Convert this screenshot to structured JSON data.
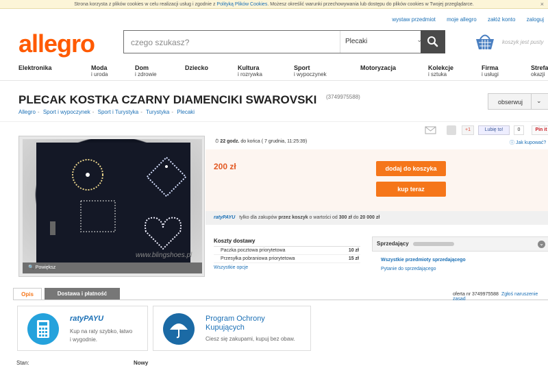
{
  "cookie": {
    "text_a": "Strona korzysta z plików cookies w celu realizacji usług i zgodnie z ",
    "link": "Polityką Plików Cookies",
    "text_b": ". Możesz określić warunki przechowywania lub dostępu do plików cookies w Twojej przeglądarce.",
    "close": "×"
  },
  "toplinks": [
    "wystaw przedmiot",
    "moje allegro",
    "załóż konto",
    "zaloguj"
  ],
  "logo": "allegro",
  "search": {
    "placeholder": "czego szukasz?",
    "category": "Plecaki"
  },
  "cart_empty": "koszyk jest pusty",
  "nav": [
    {
      "label": "Elektronika",
      "sub": ""
    },
    {
      "label": "Moda",
      "sub": "i uroda"
    },
    {
      "label": "Dom",
      "sub": "i zdrowie"
    },
    {
      "label": "Dziecko",
      "sub": ""
    },
    {
      "label": "Kultura",
      "sub": "i rozrywka"
    },
    {
      "label": "Sport",
      "sub": "i wypoczynek"
    },
    {
      "label": "Motoryzacja",
      "sub": ""
    },
    {
      "label": "Kolekcje",
      "sub": "i sztuka"
    },
    {
      "label": "Firma",
      "sub": "i usługi"
    },
    {
      "label": "Strefa",
      "sub": "okazji"
    }
  ],
  "title": "PLECAK KOSTKA CZARNY DIAMENCIKI SWAROVSKI",
  "offer_id": "(3749975588)",
  "watch_label": "obserwuj",
  "breadcrumbs": [
    "Allegro",
    "Sport i wypoczynek",
    "Sport i Turystyka",
    "Turystyka",
    "Plecaki"
  ],
  "share": {
    "gplus": "+1",
    "fb": "Lubię to!",
    "fb_count": "0",
    "pin": "Pin it"
  },
  "timer": {
    "bold": "22 godz.",
    "rest": " do końca ( 7 grudnia, 11:25:39)"
  },
  "how_to_buy": "Jak kupować?",
  "photo": {
    "enlarge": "Powiększ",
    "watermark": "www.blingshoes.pl"
  },
  "price": "200 zł",
  "buttons": {
    "add_to_cart": "dodaj do koszyka",
    "buy_now": "kup teraz"
  },
  "raty": {
    "brand": "ratyPAYU",
    "t1": " tylko dla zakupów ",
    "b1": "przez koszyk",
    "t2": " o wartości od ",
    "b2": "300 zł",
    "t3": " do ",
    "b3": "20 000 zł"
  },
  "shipping": {
    "header": "Koszty dostawy",
    "rows": [
      {
        "name": "Paczka pocztowa priorytetowa",
        "price": "10 zł"
      },
      {
        "name": "Przesyłka pobraniowa priorytetowa",
        "price": "15 zł"
      }
    ],
    "more": "Wszystkie opcje"
  },
  "seller": {
    "label": "Sprzedający",
    "links": [
      "Wszystkie przedmioty sprzedającego",
      "Pytanie do sprzedającego"
    ]
  },
  "tabs": [
    "Opis",
    "Dostawa i płatność"
  ],
  "offer_number": {
    "text": "oferta nr 3749975588",
    "report": "Zgłoś naruszenie zasad"
  },
  "cards": [
    {
      "brand": "ratyPAYU",
      "line1": "Kup na raty szybko, łatwo",
      "line2": "i wygodnie."
    },
    {
      "title1": "Program Ochrony",
      "title2": "Kupujących",
      "line1": "Ciesz się zakupami, kupuj bez obaw."
    }
  ],
  "status": {
    "label": "Stan:",
    "value": "Nowy"
  },
  "colors": {
    "brand": "#ff5a00",
    "button": "#f5761a",
    "link": "#1a6fb5"
  }
}
